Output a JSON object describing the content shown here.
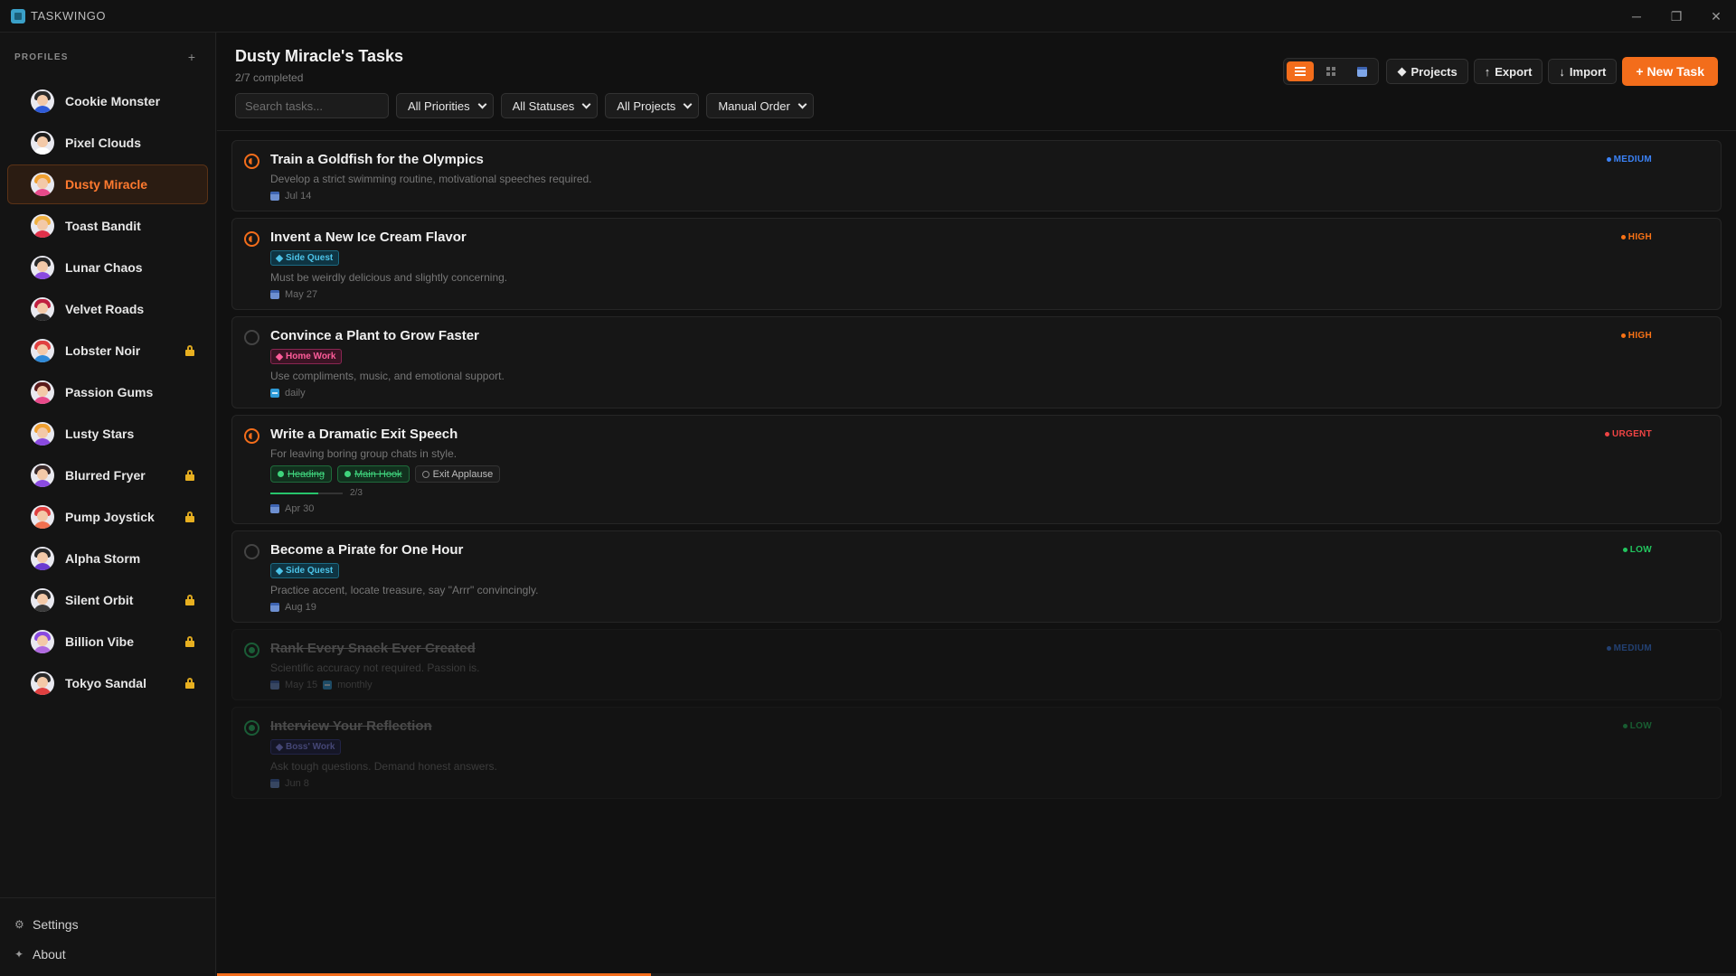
{
  "app": {
    "name": "TASKWINGO"
  },
  "window": {
    "minimize": "─",
    "maximize": "❐",
    "close": "✕"
  },
  "sidebar": {
    "section_label": "PROFILES",
    "add_label": "+",
    "profiles": [
      {
        "name": "Cookie Monster",
        "locked": false,
        "active": false,
        "hair": "#2a2a2a",
        "shirt": "#2f5bd8"
      },
      {
        "name": "Pixel Clouds",
        "locked": false,
        "active": false,
        "hair": "#1d1d1d",
        "shirt": "#ffffff"
      },
      {
        "name": "Dusty Miracle",
        "locked": false,
        "active": true,
        "hair": "#f0a030",
        "shirt": "#e84a8a"
      },
      {
        "name": "Toast Bandit",
        "locked": false,
        "active": false,
        "hair": "#f0b040",
        "shirt": "#e0304a"
      },
      {
        "name": "Lunar Chaos",
        "locked": false,
        "active": false,
        "hair": "#2a2a2a",
        "shirt": "#8a4ae0"
      },
      {
        "name": "Velvet Roads",
        "locked": false,
        "active": false,
        "hair": "#c02040",
        "shirt": "#2a2a2a"
      },
      {
        "name": "Lobster Noir",
        "locked": true,
        "active": false,
        "hair": "#e04040",
        "shirt": "#2f8ad8"
      },
      {
        "name": "Passion Gums",
        "locked": false,
        "active": false,
        "hair": "#5a1a1a",
        "shirt": "#e84a8a"
      },
      {
        "name": "Lusty Stars",
        "locked": false,
        "active": false,
        "hair": "#f0a030",
        "shirt": "#8a4ae0"
      },
      {
        "name": "Blurred Fryer",
        "locked": true,
        "active": false,
        "hair": "#3a2a2a",
        "shirt": "#8a4ae0"
      },
      {
        "name": "Pump Joystick",
        "locked": true,
        "active": false,
        "hair": "#e04040",
        "shirt": "#f07050"
      },
      {
        "name": "Alpha Storm",
        "locked": false,
        "active": false,
        "hair": "#2a2a2a",
        "shirt": "#6a3ad0"
      },
      {
        "name": "Silent Orbit",
        "locked": true,
        "active": false,
        "hair": "#2a2a2a",
        "shirt": "#3a3a3a"
      },
      {
        "name": "Billion Vibe",
        "locked": true,
        "active": false,
        "hair": "#8a4ae0",
        "shirt": "#b06ae0"
      },
      {
        "name": "Tokyo Sandal",
        "locked": true,
        "active": false,
        "hair": "#2a2a2a",
        "shirt": "#e04040"
      }
    ],
    "settings_label": "Settings",
    "about_label": "About"
  },
  "header": {
    "title": "Dusty Miracle's Tasks",
    "subtitle": "2/7 completed",
    "search_placeholder": "Search tasks...",
    "filters": [
      "All Priorities",
      "All Statuses",
      "All Projects",
      "Manual Order"
    ],
    "projects_label": "Projects",
    "export_label": "Export",
    "import_label": "Import",
    "new_task_label": "+ New Task"
  },
  "tasks": [
    {
      "title": "Train a Goldfish for the Olympics",
      "desc": "Develop a strict swimming routine, motivational speeches required.",
      "date": "Jul 14",
      "priority": "MEDIUM",
      "priority_color": "#3b82f6",
      "status": "progress",
      "done": false
    },
    {
      "title": "Invent a New Ice Cream Flavor",
      "tag": "Side Quest",
      "tag_type": "side",
      "desc": "Must be weirdly delicious and slightly concerning.",
      "date": "May 27",
      "priority": "HIGH",
      "priority_color": "#f97316",
      "status": "progress",
      "done": false
    },
    {
      "title": "Convince a Plant to Grow Faster",
      "tag": "Home Work",
      "tag_type": "home",
      "desc": "Use compliments, music, and emotional support.",
      "recur": "daily",
      "priority": "HIGH",
      "priority_color": "#f97316",
      "status": "todo",
      "done": false
    },
    {
      "title": "Write a Dramatic Exit Speech",
      "desc": "For leaving boring group chats in style.",
      "subtasks": [
        {
          "label": "Heading",
          "done": true
        },
        {
          "label": "Main Hook",
          "done": true
        },
        {
          "label": "Exit Applause",
          "done": false
        }
      ],
      "subtask_progress": "2/3",
      "subtask_ratio": 0.667,
      "date": "Apr 30",
      "priority": "URGENT",
      "priority_color": "#ef4444",
      "status": "progress",
      "done": false
    },
    {
      "title": "Become a Pirate for One Hour",
      "tag": "Side Quest",
      "tag_type": "side",
      "desc": "Practice accent, locate treasure, say \"Arrr\" convincingly.",
      "date": "Aug 19",
      "priority": "LOW",
      "priority_color": "#22c55e",
      "status": "todo",
      "done": false
    },
    {
      "title": "Rank Every Snack Ever Created",
      "desc": "Scientific accuracy not required. Passion is.",
      "date": "May 15",
      "recur": "monthly",
      "priority": "MEDIUM",
      "priority_color": "#3b82f6",
      "status": "completed",
      "done": true
    },
    {
      "title": "Interview Your Reflection",
      "tag": "Boss' Work",
      "tag_type": "boss",
      "desc": "Ask tough questions. Demand honest answers.",
      "date": "Jun 8",
      "priority": "LOW",
      "priority_color": "#22c55e",
      "status": "completed",
      "done": true
    }
  ],
  "completion_ratio": 0.2857
}
